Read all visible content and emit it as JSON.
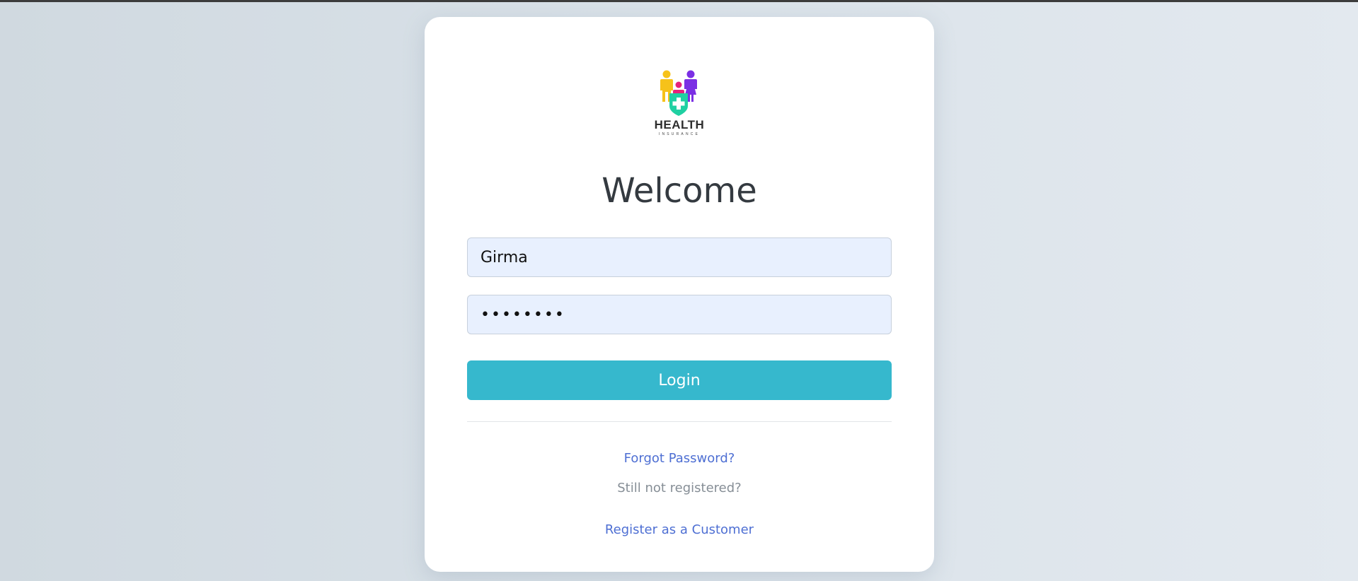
{
  "logo": {
    "wordmark": "HEALTH",
    "tagline": "INSURANCE",
    "icon": "family-health-insurance-logo-icon",
    "colors": {
      "person_left": "#f6c21a",
      "person_right": "#7b2fe4",
      "child": "#e6217a",
      "shield": "#1fd0a2"
    }
  },
  "heading": "Welcome",
  "form": {
    "username_value": "Girma",
    "password_value": "••••••••",
    "login_label": "Login"
  },
  "links": {
    "forgot_password": "Forgot Password?",
    "still_not_registered": "Still not registered?",
    "register": "Register as a Customer"
  },
  "colors": {
    "accent": "#36b8cd",
    "link": "#4e6fd3",
    "input_bg": "#e8f0fe",
    "heading": "#343a40",
    "muted": "#868e96"
  }
}
